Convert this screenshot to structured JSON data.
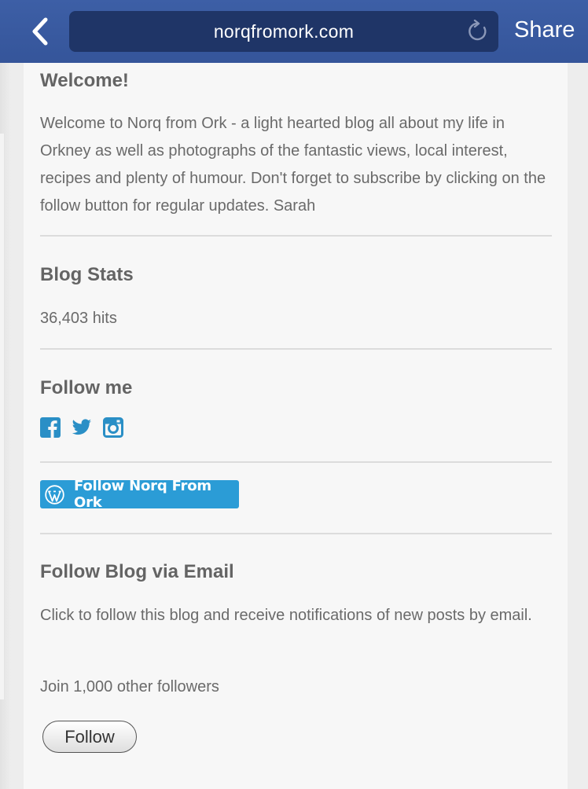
{
  "browser": {
    "url": "norqfromork.com",
    "share_label": "Share",
    "back_icon": "chevron-left-icon",
    "reload_icon": "reload-icon"
  },
  "welcome": {
    "title": "Welcome!",
    "body": "Welcome to Norq from Ork - a light hearted blog all about my life in Orkney as well as photographs of the fantastic views, local interest, recipes and plenty of humour. Don't forget to subscribe by clicking on the follow button for regular updates. Sarah"
  },
  "stats": {
    "title": "Blog Stats",
    "hits": "36,403 hits"
  },
  "follow_me": {
    "title": "Follow me",
    "icons": [
      "facebook-icon",
      "twitter-icon",
      "instagram-icon"
    ]
  },
  "wp_follow": {
    "label": "Follow Norq From Ork"
  },
  "email_follow": {
    "title": "Follow Blog via Email",
    "body": "Click to follow this blog and receive notifications of new posts by email.",
    "followers": "Join 1,000 other followers",
    "button": "Follow"
  },
  "colors": {
    "topbar": "#3b5998",
    "urlbar": "#1f3567",
    "social_icon": "#2a8fc6",
    "wp_button": "#2b9cd6"
  }
}
